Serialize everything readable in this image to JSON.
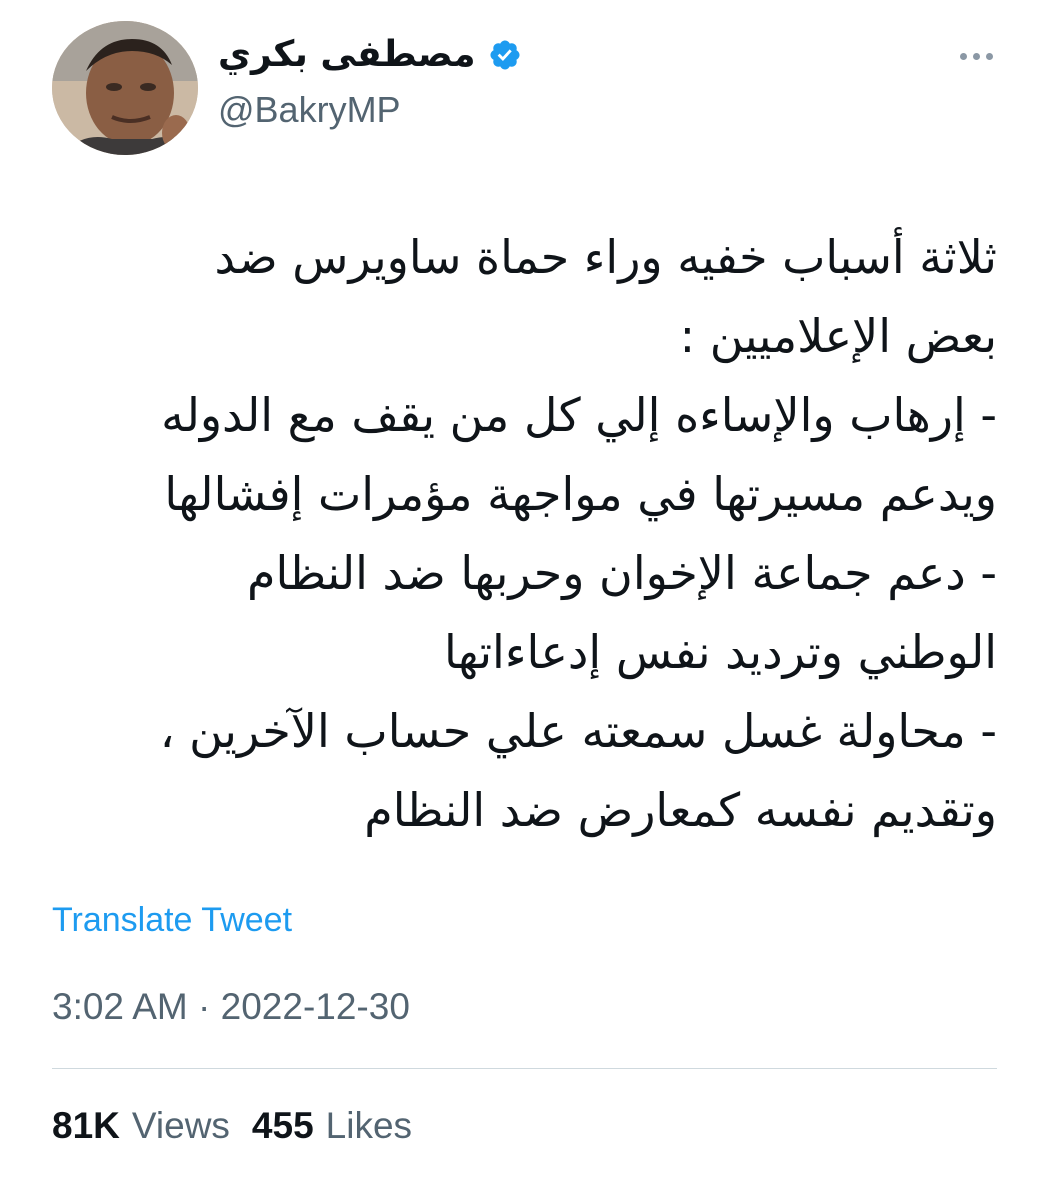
{
  "author": {
    "display_name": "مصطفى بكري",
    "handle": "@BakryMP",
    "verified_icon": "verified-badge-icon",
    "avatar_icon": "avatar-photo"
  },
  "menu": {
    "more_icon": "more-options-icon"
  },
  "tweet": {
    "lines": [
      "ثلاثة أسباب خفيه وراء حماة ساويرس ضد",
      "بعض الإعلاميين :",
      "- إرهاب والإساءه إلي كل من يقف مع الدوله",
      "ويدعم مسيرتها في مواجهة مؤمرات إفشالها",
      "- دعم جماعة الإخوان وحربها ضد النظام",
      "الوطني وترديد نفس إدعاءاتها",
      "- محاولة غسل سمعته علي حساب الآخرين ،",
      "وتقديم نفسه كمعارض ضد النظام"
    ]
  },
  "translate_label": "Translate Tweet",
  "timestamp": "3:02 AM · 2022-12-30",
  "stats": {
    "views_count": "81K",
    "views_label": "Views",
    "likes_count": "455",
    "likes_label": "Likes"
  },
  "colors": {
    "accent": "#1d9bf0",
    "secondary_text": "#536471",
    "primary_text": "#0f1419"
  }
}
